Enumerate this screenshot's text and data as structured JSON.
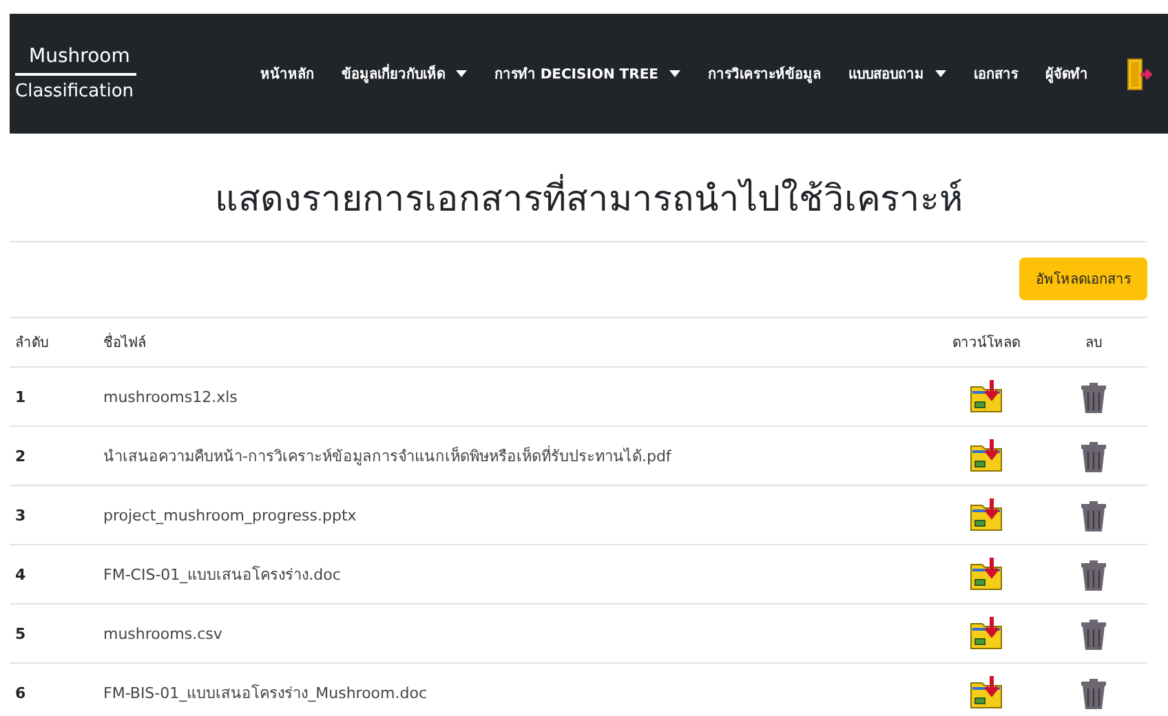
{
  "navbar": {
    "brand": {
      "line1": "Mushroom",
      "line2": "Classification"
    },
    "items": [
      {
        "label": "หน้าหลัก",
        "kind": "link"
      },
      {
        "label": "ข้อมูลเกี่ยวกับเห็ด",
        "kind": "dropdown"
      },
      {
        "label": "การทำ DECISION TREE",
        "kind": "dropdown"
      },
      {
        "label": "การวิเคราะห์ข้อมูล",
        "kind": "link"
      },
      {
        "label": "แบบสอบถาม",
        "kind": "dropdown"
      },
      {
        "label": "เอกสาร",
        "kind": "link"
      },
      {
        "label": "ผู้จัดทำ",
        "kind": "link"
      }
    ]
  },
  "heading": "แสดงรายการเอกสารที่สามารถนำไปใช้วิเคราะห์",
  "upload_button": "อัพโหลดเอกสาร",
  "table": {
    "columns": [
      "ลำดับ",
      "ชื่อไฟล์",
      "ดาวน์โหลด",
      "ลบ"
    ],
    "rows": [
      {
        "number": "1",
        "filename": "mushrooms12.xls"
      },
      {
        "number": "2",
        "filename": "นำเสนอความคืบหน้า-การวิเคราะห์ข้อมูลการจำแนกเห็ดพิษหรือเห็ดที่รับประทานได้.pdf"
      },
      {
        "number": "3",
        "filename": "project_mushroom_progress.pptx"
      },
      {
        "number": "4",
        "filename": "FM-CIS-01_แบบเสนอโครงร่าง.doc"
      },
      {
        "number": "5",
        "filename": "mushrooms.csv"
      },
      {
        "number": "6",
        "filename": "FM-BIS-01_แบบเสนอโครงร่าง_Mushroom.doc"
      }
    ]
  }
}
